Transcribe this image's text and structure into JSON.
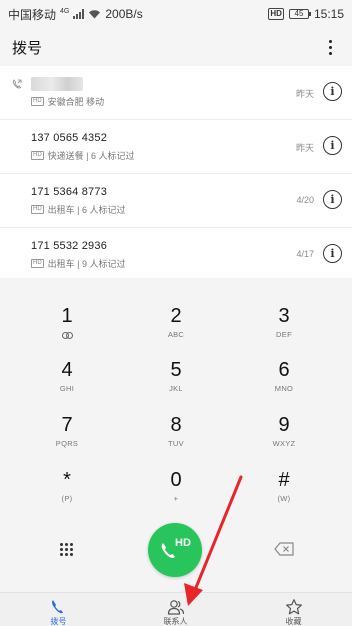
{
  "status_bar": {
    "carrier": "中国移动",
    "network": "4G",
    "speed": "200B/s",
    "hd": "HD",
    "battery": "45",
    "time": "15:15"
  },
  "header": {
    "title": "拨号",
    "more_icon": "more-vertical-icon"
  },
  "call_log": [
    {
      "number": "",
      "redacted": true,
      "badge": "HD",
      "subtitle": "安徽合肥 移动",
      "date": "昨天"
    },
    {
      "number": "137 0565 4352",
      "badge": "HD",
      "subtitle": "快递送餐 | 6 人标记过",
      "date": "昨天"
    },
    {
      "number": "171 5364 8773",
      "badge": "HD",
      "subtitle": "出租车 | 6 人标记过",
      "date": "4/20"
    },
    {
      "number": "171 5532 2936",
      "badge": "HD",
      "subtitle": "出租车 | 9 人标记过",
      "date": "4/17"
    }
  ],
  "keypad": [
    {
      "digit": "1",
      "letters": ""
    },
    {
      "digit": "2",
      "letters": "ABC"
    },
    {
      "digit": "3",
      "letters": "DEF"
    },
    {
      "digit": "4",
      "letters": "GHI"
    },
    {
      "digit": "5",
      "letters": "JKL"
    },
    {
      "digit": "6",
      "letters": "MNO"
    },
    {
      "digit": "7",
      "letters": "PQRS"
    },
    {
      "digit": "8",
      "letters": "TUV"
    },
    {
      "digit": "9",
      "letters": "WXYZ"
    },
    {
      "digit": "*",
      "letters": "(P)"
    },
    {
      "digit": "0",
      "letters": "+"
    },
    {
      "digit": "#",
      "letters": "(W)"
    }
  ],
  "call_button": {
    "label": "HD",
    "color": "#27c55c"
  },
  "bottom_nav": [
    {
      "label": "拨号",
      "icon": "phone-icon",
      "active": true
    },
    {
      "label": "联系人",
      "icon": "contacts-icon",
      "active": false
    },
    {
      "label": "收藏",
      "icon": "star-icon",
      "active": false
    }
  ],
  "colors": {
    "accent": "#2b6de0",
    "call_green": "#27c55c",
    "annotation_red": "#e8262a"
  }
}
